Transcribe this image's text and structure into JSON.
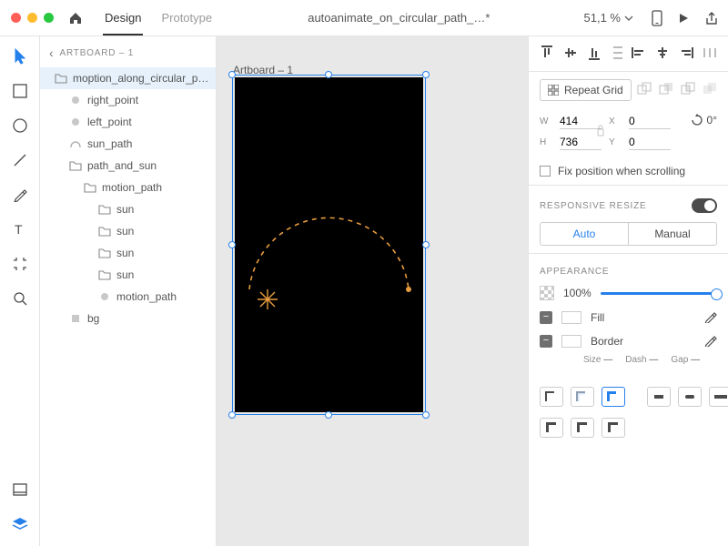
{
  "titlebar": {
    "tabs": {
      "design": "Design",
      "prototype": "Prototype"
    },
    "doc_title": "autoanimate_on_circular_path_…*",
    "zoom": "51,1 %"
  },
  "layers": {
    "breadcrumb": "ARTBOARD – 1",
    "items": [
      {
        "label": "moption_along_circular_pa…",
        "icon": "folder",
        "depth": 0,
        "selected": true
      },
      {
        "label": "right_point",
        "icon": "dot",
        "depth": 1
      },
      {
        "label": "left_point",
        "icon": "dot",
        "depth": 1
      },
      {
        "label": "sun_path",
        "icon": "path",
        "depth": 1
      },
      {
        "label": "path_and_sun",
        "icon": "folder",
        "depth": 1
      },
      {
        "label": "motion_path",
        "icon": "folder",
        "depth": 2
      },
      {
        "label": "sun",
        "icon": "folder",
        "depth": 3
      },
      {
        "label": "sun",
        "icon": "folder",
        "depth": 3
      },
      {
        "label": "sun",
        "icon": "folder",
        "depth": 3
      },
      {
        "label": "sun",
        "icon": "folder",
        "depth": 3
      },
      {
        "label": "motion_path",
        "icon": "dot",
        "depth": 3
      },
      {
        "label": "bg",
        "icon": "layer",
        "depth": 1
      }
    ]
  },
  "canvas": {
    "artboard_label": "Artboard – 1"
  },
  "inspector": {
    "repeat_grid": "Repeat Grid",
    "w_label": "W",
    "w": "414",
    "h_label": "H",
    "h": "736",
    "x_label": "X",
    "x": "0",
    "y_label": "Y",
    "y": "0",
    "rotation": "0°",
    "fix_label": "Fix position when scrolling",
    "resp_header": "RESPONSIVE RESIZE",
    "auto": "Auto",
    "manual": "Manual",
    "appearance": "APPEARANCE",
    "opacity": "100%",
    "fill": "Fill",
    "border": "Border",
    "size": "Size",
    "dash": "Dash",
    "gap": "Gap",
    "meta_dash": "—"
  }
}
